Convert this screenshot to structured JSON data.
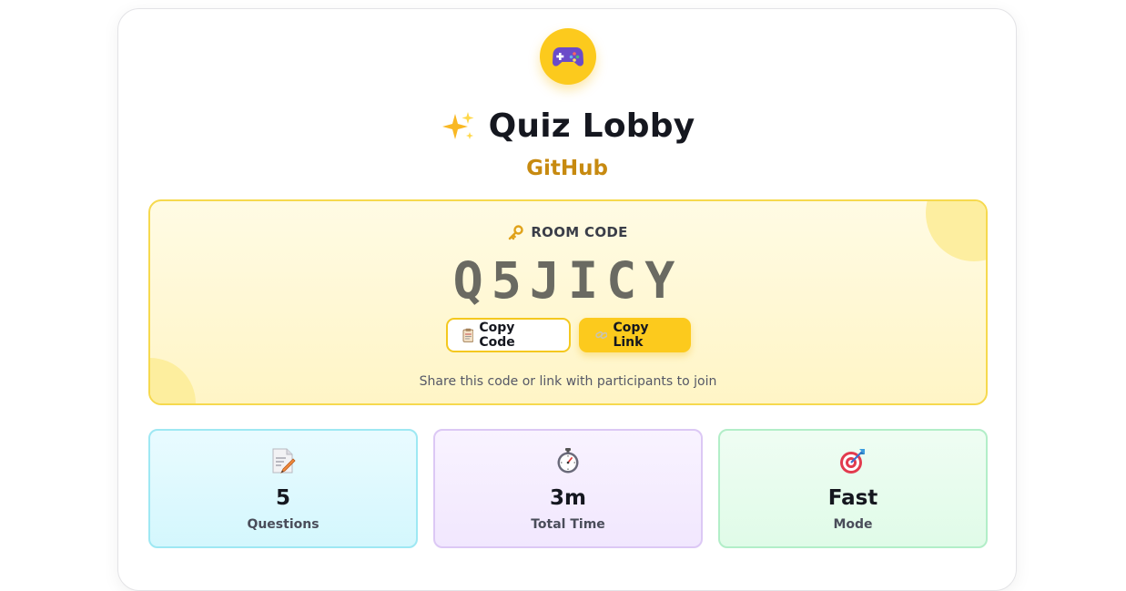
{
  "header": {
    "logo_icon": "game-controller-icon",
    "title_icon": "sparkles-icon",
    "title": "Quiz Lobby",
    "subtitle": "GitHub"
  },
  "room": {
    "label_icon": "key-icon",
    "label": "ROOM CODE",
    "code": "Q5JICY",
    "copy_code_icon": "clipboard-icon",
    "copy_code_label": "Copy Code",
    "copy_link_icon": "link-icon",
    "copy_link_label": "Copy Link",
    "share_text": "Share this code or link with participants to join"
  },
  "stats": [
    {
      "icon": "memo-icon",
      "value": "5",
      "label": "Questions"
    },
    {
      "icon": "stopwatch-icon",
      "value": "3m",
      "label": "Total Time"
    },
    {
      "icon": "target-icon",
      "value": "Fast",
      "label": "Mode"
    }
  ],
  "colors": {
    "accent": "#fcca1d",
    "subtitle": "#c78a10",
    "room_border": "#f6d94e",
    "stat_cyan_border": "#9ee8f3",
    "stat_purple_border": "#dcc8f5",
    "stat_green_border": "#b2eec8"
  }
}
